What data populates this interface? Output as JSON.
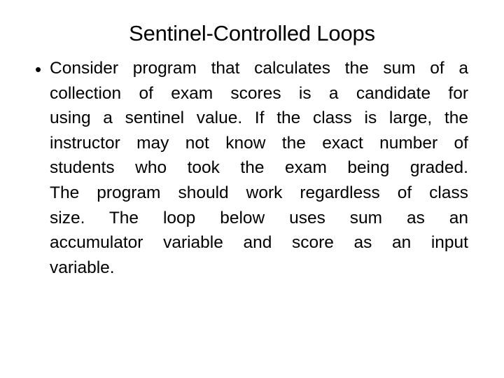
{
  "slide": {
    "title": "Sentinel-Controlled Loops",
    "bullet_symbol": "•",
    "bullet_lines": [
      "Consider program that calculates the sum of a",
      "collection of exam scores is a candidate for",
      "using a sentinel value. If the class is large, the",
      "instructor may not know the exact number of",
      "students who took the exam being graded.",
      "The program should work regardless of class",
      "size. The loop below uses  sum  as an",
      "accumulator variable and  score  as an input",
      "variable."
    ]
  }
}
